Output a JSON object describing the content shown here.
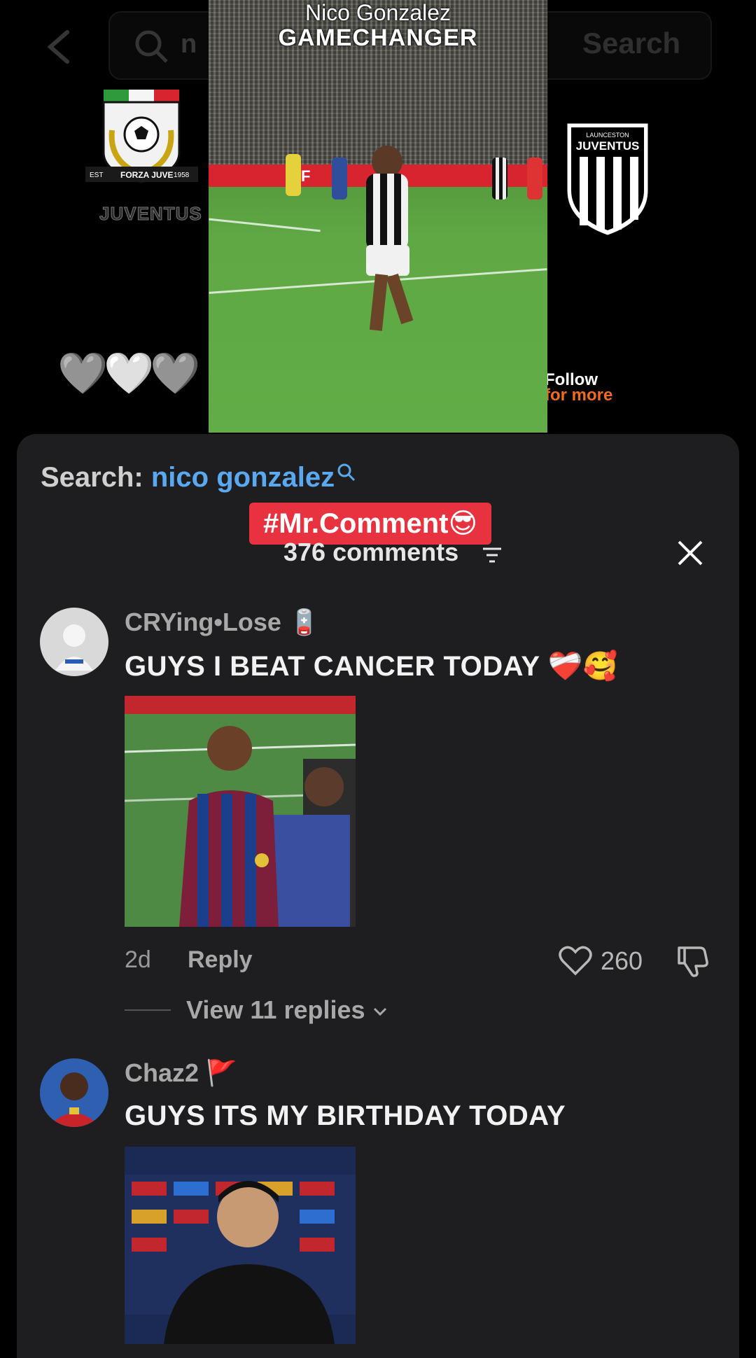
{
  "search": {
    "query_partial": "n",
    "button_label": "Search"
  },
  "video": {
    "title_line1": "Nico Gonzalez",
    "title_line2": "GAMECHANGER",
    "ad_text": "F",
    "left_crest_text": "JUVENTUS",
    "left_crest_banner": "FORZA JUVE",
    "left_crest_est": "EST",
    "left_crest_year": "1958",
    "right_crest_top": "LAUNCESTON",
    "right_crest_name": "JUVENTUS",
    "hearts": "🩶🤍🩶",
    "follow_line1": "Follow",
    "follow_line2": "for more"
  },
  "panel": {
    "search_label": "Search:",
    "search_query": "nico gonzalez",
    "hashtag": "#Mr.Comment😎",
    "comment_count": "376 comments",
    "close_icon": "close-icon"
  },
  "comments": [
    {
      "username": "CRYing•Lose",
      "username_badge": "🪫",
      "text": "GUYS I BEAT CANCER TODAY ❤️‍🩹🥰",
      "time": "2d",
      "reply_label": "Reply",
      "likes": "260",
      "view_replies": "View 11 replies"
    },
    {
      "username": "Chaz2",
      "username_badge": "🚩",
      "text": "GUYS ITS MY BIRTHDAY TODAY"
    }
  ],
  "colors": {
    "panel_bg": "#1e1e20",
    "link_blue": "#5aa9f0",
    "hashtag_red": "#e8323f",
    "follow_orange": "#f26b1d"
  }
}
